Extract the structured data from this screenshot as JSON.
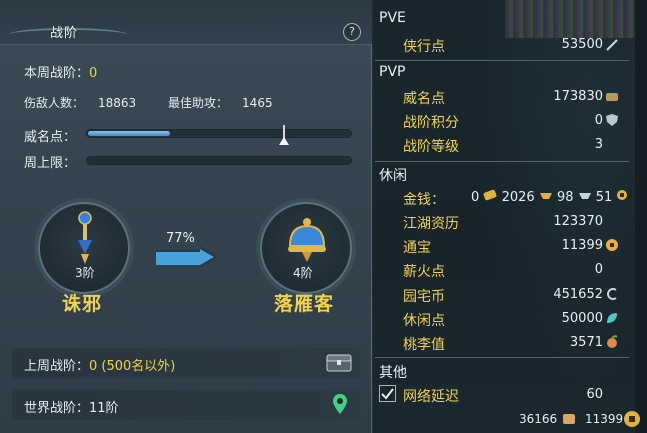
{
  "rank_panel": {
    "title": "战阶",
    "help": "?",
    "weekly_rank_label": "本周战阶：",
    "weekly_rank_value": "0",
    "enemies_label": "伤敌人数：",
    "enemies_value": "18863",
    "best_assist_label": "最佳助攻：",
    "best_assist_value": "1465",
    "prestige_label": "威名点：",
    "prestige_progress": 0.31,
    "weekly_cap_label": "周上限：",
    "weekly_cap_progress": 0,
    "progress_percent": "77%",
    "left_emblem": {
      "level": "3阶",
      "name": "诛邪",
      "icon": "sword-gem-icon"
    },
    "right_emblem": {
      "level": "4阶",
      "name": "落雁客",
      "icon": "helmet-gem-icon"
    },
    "last_week_label": "上周战阶：",
    "last_week_value": "0 (500名以外)",
    "world_rank_label": "世界战阶：",
    "world_rank_value": "11阶"
  },
  "stats_panel": {
    "pve": {
      "title": "PVE",
      "items": [
        {
          "label": "侠行点",
          "value": "53500"
        }
      ]
    },
    "pvp": {
      "title": "PVP",
      "items": [
        {
          "label": "威名点",
          "value": "173830"
        },
        {
          "label": "战阶积分",
          "value": "0"
        },
        {
          "label": "战阶等级",
          "value": "3"
        }
      ]
    },
    "leisure": {
      "title": "休闲",
      "money_label": "金钱：",
      "money_gold": "0",
      "money_silver": "2026",
      "money_copper1": "98",
      "money_copper2": "51",
      "items": [
        {
          "label": "江湖资历",
          "value": "123370"
        },
        {
          "label": "通宝",
          "value": "11399"
        },
        {
          "label": "薪火点",
          "value": "0"
        },
        {
          "label": "园宅币",
          "value": "451652"
        },
        {
          "label": "休闲点",
          "value": "50000"
        },
        {
          "label": "桃李值",
          "value": "3571"
        }
      ]
    },
    "other": {
      "title": "其他",
      "latency_label": "网络延迟",
      "latency_value": "60",
      "latency_checked": true
    }
  },
  "footer": {
    "left_value": "36166",
    "right_value": "11399"
  },
  "colors": {
    "accent_yellow": "#f0d34a",
    "bar_blue": "#3f8ed0",
    "jade": "#3fd08a"
  }
}
